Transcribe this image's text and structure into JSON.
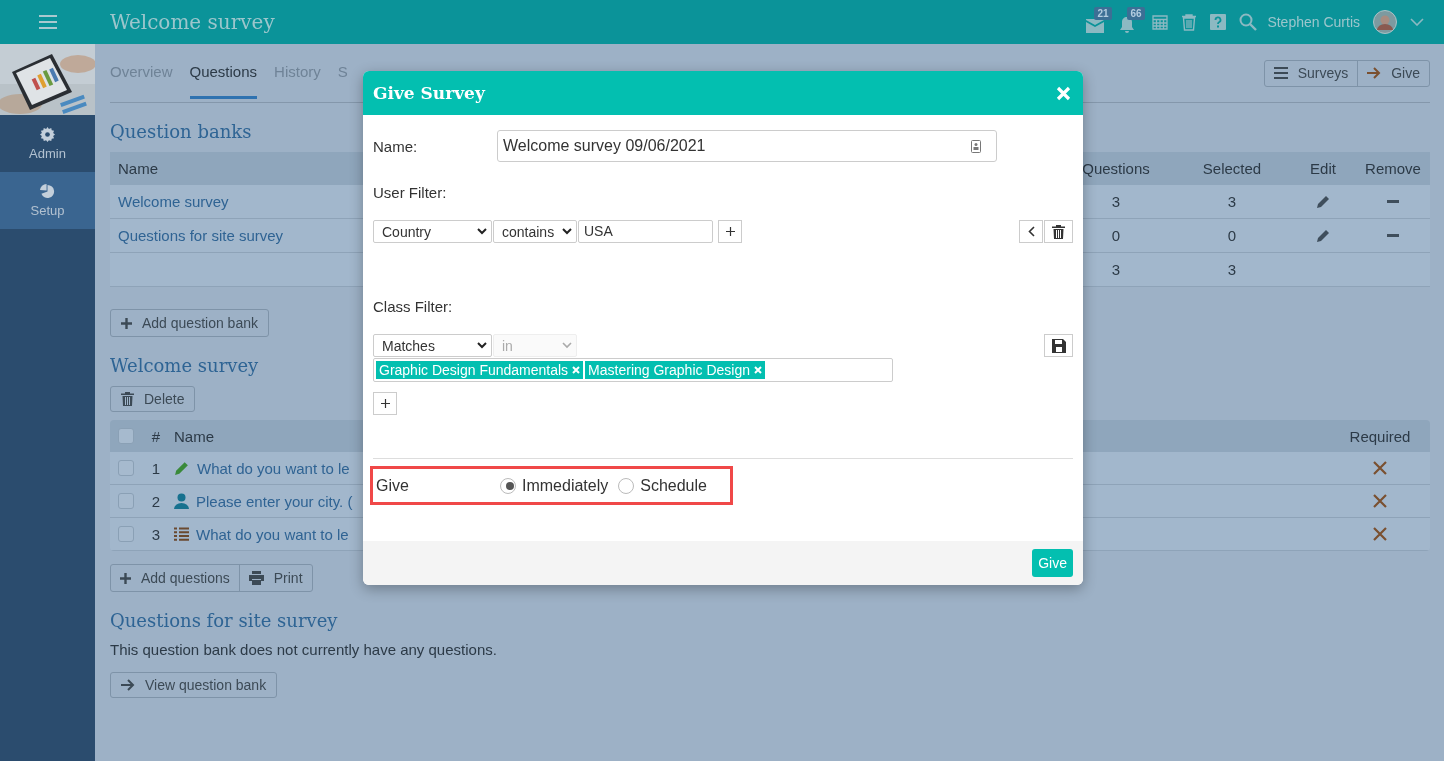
{
  "app_bar": {
    "title": "Welcome survey",
    "notifications": [
      {
        "kind": "mail",
        "count": "21"
      },
      {
        "kind": "bell",
        "count": "66"
      }
    ],
    "user": "Stephen Curtis"
  },
  "sidebar": {
    "items": [
      {
        "label": "Admin",
        "kind": "gear",
        "selected": false
      },
      {
        "label": "Setup",
        "kind": "pie",
        "selected": true
      }
    ]
  },
  "tabs": [
    {
      "label": "Overview",
      "selected": false
    },
    {
      "label": "Questions",
      "selected": true
    },
    {
      "label": "History",
      "selected": false
    },
    {
      "label": "S",
      "selected": false
    }
  ],
  "actions": [
    "Surveys",
    "Give"
  ],
  "question_banks": {
    "title": "Question banks",
    "columns": [
      "Name",
      "Questions",
      "Selected",
      "Edit",
      "Remove"
    ],
    "rows": [
      {
        "kind": "bank",
        "name": "Welcome survey",
        "questions": "3",
        "selected": "3"
      },
      {
        "kind": "bank",
        "name": "Questions for site survey",
        "questions": "0",
        "selected": "0"
      },
      {
        "kind": "total",
        "questions": "3",
        "selected": "3"
      }
    ],
    "add_button": "Add question bank"
  },
  "survey": {
    "title": "Welcome survey",
    "delete_button": "Delete",
    "columns": [
      "#",
      "Name",
      "Required"
    ],
    "all_checked": false,
    "rows": [
      {
        "number": "1",
        "kind": "text",
        "name": "What do you want to le",
        "checked": false,
        "required": false
      },
      {
        "number": "2",
        "kind": "user",
        "name": "Please enter your city. (",
        "checked": false,
        "required": false
      },
      {
        "number": "3",
        "kind": "list",
        "name": "What do you want to le",
        "checked": false,
        "required": false
      }
    ],
    "buttons": [
      "Add questions",
      "Print"
    ]
  },
  "site_survey": {
    "title": "Questions for site survey",
    "message": "This question bank does not currently have any questions.",
    "button": "View question bank"
  },
  "dialog": {
    "title": "Give Survey",
    "name_label": "Name:",
    "name_value": "Welcome survey 09/06/2021",
    "user_filter": {
      "label": "User Filter:",
      "field": "Country",
      "operator": "contains",
      "value": "USA"
    },
    "class_filter": {
      "label": "Class Filter:",
      "match": "Matches",
      "operator": "in",
      "operator_disabled": true,
      "tags": [
        "Graphic Design Fundamentals",
        "Mastering Graphic Design"
      ]
    },
    "give": {
      "label": "Give",
      "highlighted": true,
      "options": [
        {
          "label": "Immediately",
          "selected": true
        },
        {
          "label": "Schedule",
          "selected": false
        }
      ]
    },
    "submit": "Give"
  }
}
